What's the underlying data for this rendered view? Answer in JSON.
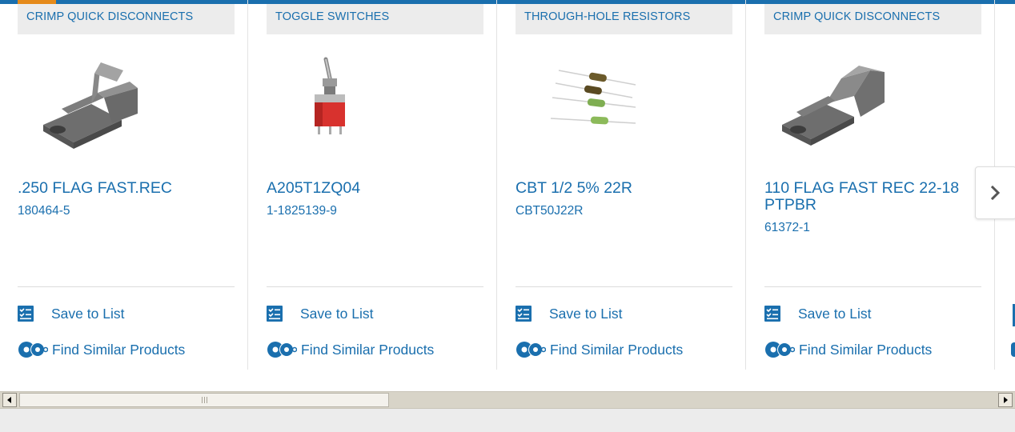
{
  "products": [
    {
      "category": "CRIMP QUICK DISCONNECTS",
      "name": ".250 FLAG FAST.REC",
      "part_number": "180464-5",
      "image": "flag-receptacle-image"
    },
    {
      "category": "TOGGLE SWITCHES",
      "name": "A205T1ZQ04",
      "part_number": "1-1825139-9",
      "image": "toggle-switch-image"
    },
    {
      "category": "THROUGH-HOLE RESISTORS",
      "name": "CBT 1/2 5% 22R",
      "part_number": "CBT50J22R",
      "image": "resistors-image"
    },
    {
      "category": "CRIMP QUICK DISCONNECTS",
      "name": "110 FLAG FAST REC 22-18 PTPBR",
      "part_number": "61372-1",
      "image": "flag-receptacle-image"
    }
  ],
  "actions": {
    "save_label": "Save to List",
    "similar_label": "Find Similar Products"
  },
  "icons": {
    "save": "checklist-icon",
    "similar": "gears-icon",
    "next": "chevron-right-icon",
    "scroll_left": "triangle-left-icon",
    "scroll_right": "triangle-right-icon"
  },
  "colors": {
    "accent": "#1a6fae",
    "top_accent": "#e58a1b",
    "category_bg": "#ececec"
  }
}
